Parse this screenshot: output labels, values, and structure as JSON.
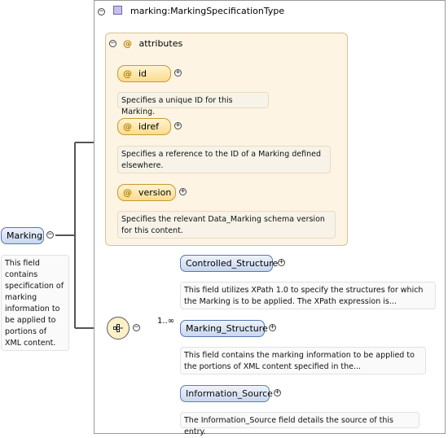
{
  "root": {
    "name": "Marking",
    "description": "This field contains specification of marking information to be applied to portions of XML content."
  },
  "type": {
    "name": "marking:MarkingSpecificationType"
  },
  "attributes": {
    "label": "attributes",
    "symbol": "@",
    "items": [
      {
        "name": "id",
        "description": "Specifies a unique ID for this Marking."
      },
      {
        "name": "idref",
        "description": "Specifies a reference to the ID of a Marking defined elsewhere."
      },
      {
        "name": "version",
        "description": "Specifies the relevant Data_Marking schema version for this content."
      }
    ]
  },
  "sequence": {
    "children": [
      {
        "name": "Controlled_Structure",
        "cardinality": "",
        "description": "This field utilizes XPath 1.0 to specify the structures for which the Marking is to be applied. The XPath expression is..."
      },
      {
        "name": "Marking_Structure",
        "cardinality": "1..∞",
        "description": "This field contains the marking information to be applied to the portions of XML content specified in the..."
      },
      {
        "name": "Information_Source",
        "cardinality": "",
        "description": "The Information_Source field details the source of this entry."
      }
    ]
  },
  "toggles": {
    "collapse": "−",
    "expand": "+"
  },
  "colors": {
    "attribute_fill": "#fdf4e3",
    "element_fill": "#c8d6ef",
    "element_border": "#5778b0",
    "attribute_border": "#c79a34"
  }
}
